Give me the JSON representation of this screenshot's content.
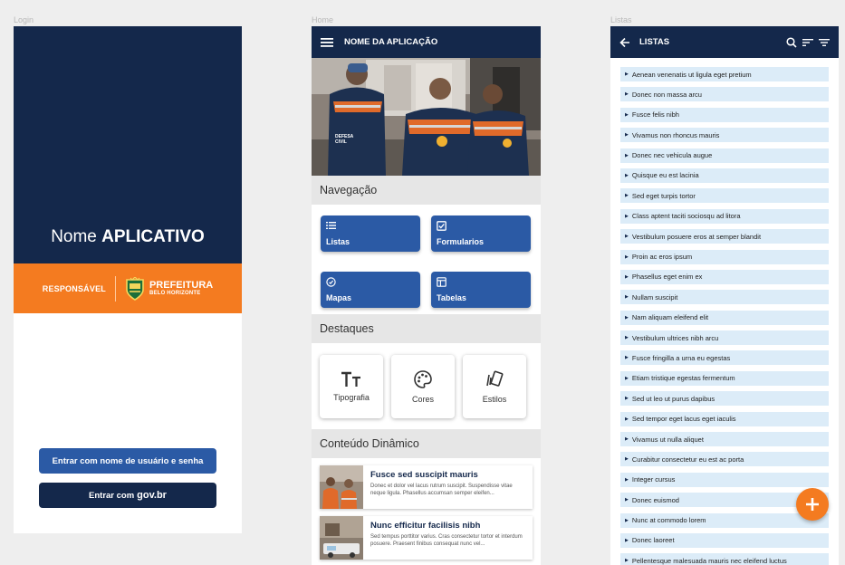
{
  "frames": {
    "login_label": "Login",
    "home_label": "Home",
    "listas_label": "Listas"
  },
  "login": {
    "app_name_prefix": "Nome ",
    "app_name_bold": "APLICATIVO",
    "responsavel": "RESPONSÁVEL",
    "prefeitura_line1": "PREFEITURA",
    "prefeitura_line2": "BELO HORIZONTE",
    "btn_user": "Entrar com nome de usuário e senha",
    "btn_gov_prefix": "Entrar com",
    "btn_gov_bold": "gov.br",
    "colors": {
      "navy": "#14284b",
      "orange": "#f47b20",
      "blue": "#2b5aa5"
    }
  },
  "home": {
    "title": "NOME DA APLICAÇÃO",
    "hero_vest_text": "DEFESA CIVIL",
    "nav_section": "Navegação",
    "nav": [
      {
        "label": "Listas",
        "icon": "list-icon"
      },
      {
        "label": "Formularios",
        "icon": "checkbox-icon"
      },
      {
        "label": "Mapas",
        "icon": "map-pin-icon"
      },
      {
        "label": "Tabelas",
        "icon": "table-icon"
      }
    ],
    "dest_section": "Destaques",
    "destaques": [
      {
        "label": "Tipografia",
        "icon": "typography-icon"
      },
      {
        "label": "Cores",
        "icon": "palette-icon"
      },
      {
        "label": "Estilos",
        "icon": "styles-icon"
      }
    ],
    "dyn_section": "Conteúdo Dinâmico",
    "dynamic": [
      {
        "title": "Fusce sed suscipit mauris",
        "text": "Donec et dolor vel lacus rutrum suscipit. Suspendisse vitae neque ligula. Phasellus accumsan semper eleifen..."
      },
      {
        "title": "Nunc efficitur facilisis nibh",
        "text": "Sed tempus porttitor varius. Cras consectetur tortor et interdum posuere. Praesent finibus consequat nunc vel..."
      }
    ]
  },
  "listas": {
    "title": "LISTAS",
    "items": [
      "Aenean venenatis ut ligula eget pretium",
      "Donec non massa arcu",
      "Fusce felis nibh",
      "Vivamus non rhoncus mauris",
      "Donec nec vehicula augue",
      "Quisque eu est lacinia",
      "Sed eget turpis tortor",
      "Class aptent taciti sociosqu ad litora",
      "Vestibulum posuere eros at semper blandit",
      "Proin ac eros ipsum",
      "Phasellus eget enim ex",
      "Nullam suscipit",
      "Nam aliquam eleifend elit",
      "Vestibulum ultrices nibh arcu",
      "Fusce fringilla a urna eu egestas",
      "Etiam tristique egestas fermentum",
      "Sed ut leo ut purus dapibus",
      "Sed tempor eget lacus eget iaculis",
      "Vivamus ut nulla aliquet",
      "Curabitur consectetur eu est ac porta",
      "Integer cursus",
      "Donec euismod",
      "Nunc at commodo lorem",
      "Donec laoreet",
      "Pellentesque malesuada mauris nec eleifend luctus"
    ]
  }
}
